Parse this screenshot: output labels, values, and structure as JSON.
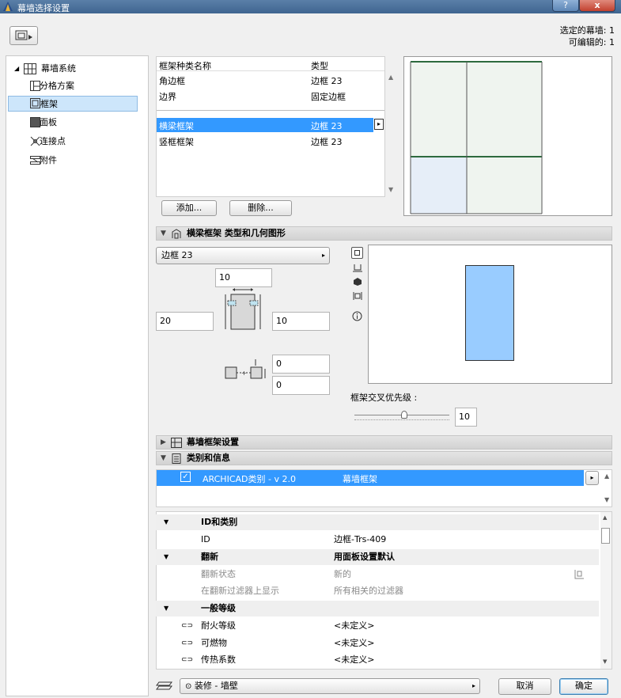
{
  "window": {
    "title": "幕墙选择设置",
    "help": "?",
    "close": "x"
  },
  "header": {
    "selected_label": "选定的幕墙: 1",
    "editable_label": "可编辑的: 1"
  },
  "nav": {
    "root": "幕墙系统",
    "items": [
      {
        "label": "分格方案",
        "icon": "grid-scheme-icon"
      },
      {
        "label": "框架",
        "icon": "frame-icon"
      },
      {
        "label": "面板",
        "icon": "panel-icon"
      },
      {
        "label": "连接点",
        "icon": "junction-icon"
      },
      {
        "label": "附件",
        "icon": "accessory-icon"
      }
    ]
  },
  "frame_list": {
    "col_name": "框架种类名称",
    "col_type": "类型",
    "rows": [
      {
        "name": "角边框",
        "type": "边框 23"
      },
      {
        "name": "边界",
        "type": "固定边框"
      },
      {
        "name": "横梁框架",
        "type": "边框 23"
      },
      {
        "name": "竖框框架",
        "type": "边框 23"
      }
    ],
    "add_button": "添加...",
    "delete_button": "删除..."
  },
  "type_section": {
    "title": "横梁框架 类型和几何图形"
  },
  "geometry": {
    "type_dropdown": "边框 23",
    "top": "10",
    "left": "20",
    "right": "10",
    "offset1": "0",
    "offset2": "0",
    "priority_label": "框架交叉优先级 :",
    "priority_value": "10"
  },
  "curtainwall_frame_section": {
    "title": "幕墙框架设置"
  },
  "classification_section": {
    "title": "类别和信息",
    "row_label": "ARCHICAD类别 - v 2.0",
    "row_value": "幕墙框架"
  },
  "properties": [
    {
      "kind": "group",
      "name": "ID和类别",
      "value": ""
    },
    {
      "kind": "item",
      "name": "ID",
      "value": "边框-Trs-409",
      "gray": false
    },
    {
      "kind": "group",
      "name": "翻新",
      "value": "用面板设置默认"
    },
    {
      "kind": "item",
      "name": "翻新状态",
      "value": "新的",
      "gray": true
    },
    {
      "kind": "item",
      "name": "在翻新过滤器上显示",
      "value": "所有相关的过滤器",
      "gray": true
    },
    {
      "kind": "group",
      "name": "一般等级",
      "value": ""
    },
    {
      "kind": "link",
      "name": "耐火等级",
      "value": "<未定义>",
      "gray": false
    },
    {
      "kind": "link",
      "name": "可燃物",
      "value": "<未定义>",
      "gray": false
    },
    {
      "kind": "link",
      "name": "传热系数",
      "value": "<未定义>",
      "gray": false
    }
  ],
  "footer": {
    "layer": "装修 - 墙壁",
    "cancel": "取消",
    "ok": "确定"
  }
}
